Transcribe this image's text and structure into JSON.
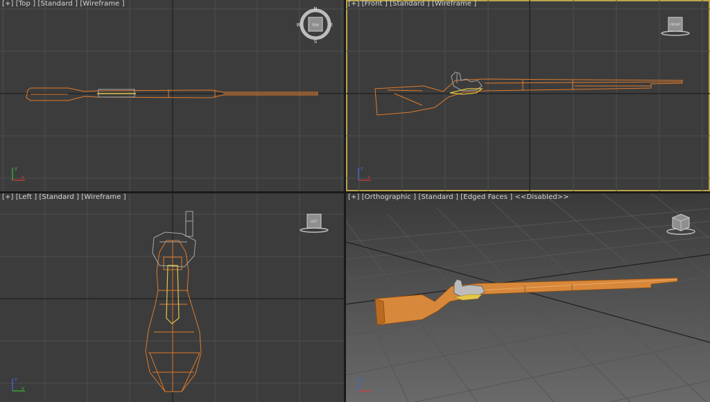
{
  "viewports": {
    "top": {
      "label_parts": [
        "[+]",
        "[Top ]",
        "[Standard ]",
        "[Wireframe ]"
      ],
      "cube_label": "TOP",
      "compass": {
        "n": "N",
        "s": "S",
        "e": "E",
        "w": "W"
      }
    },
    "front": {
      "label_parts": [
        "[+]",
        "[Front ]",
        "[Standard ]",
        "[Wireframe ]"
      ],
      "cube_label": "FRONT"
    },
    "left": {
      "label_parts": [
        "[+]",
        "[Left ]",
        "[Standard ]",
        "[Wireframe ]"
      ],
      "cube_label": "LEFT"
    },
    "ortho": {
      "label_parts": [
        "[+]",
        "[Orthographic ]",
        "[Standard ]",
        "[Edged Faces ]",
        "<<Disabled>>"
      ]
    }
  },
  "axis": {
    "x": "x",
    "y": "y",
    "z": "z"
  },
  "colors": {
    "viewport_bg": "#3c3c3c",
    "grid": "#4e4e4e",
    "grid_axis": "#1e1e1e",
    "model_wire": "#e07c2c",
    "metal_wire": "#a8a8a8",
    "brass": "#e3c64a",
    "active_border": "#b9a64a",
    "axis_x": "#d33b3b",
    "axis_y": "#3bb53b",
    "axis_z": "#3b6bd3"
  }
}
